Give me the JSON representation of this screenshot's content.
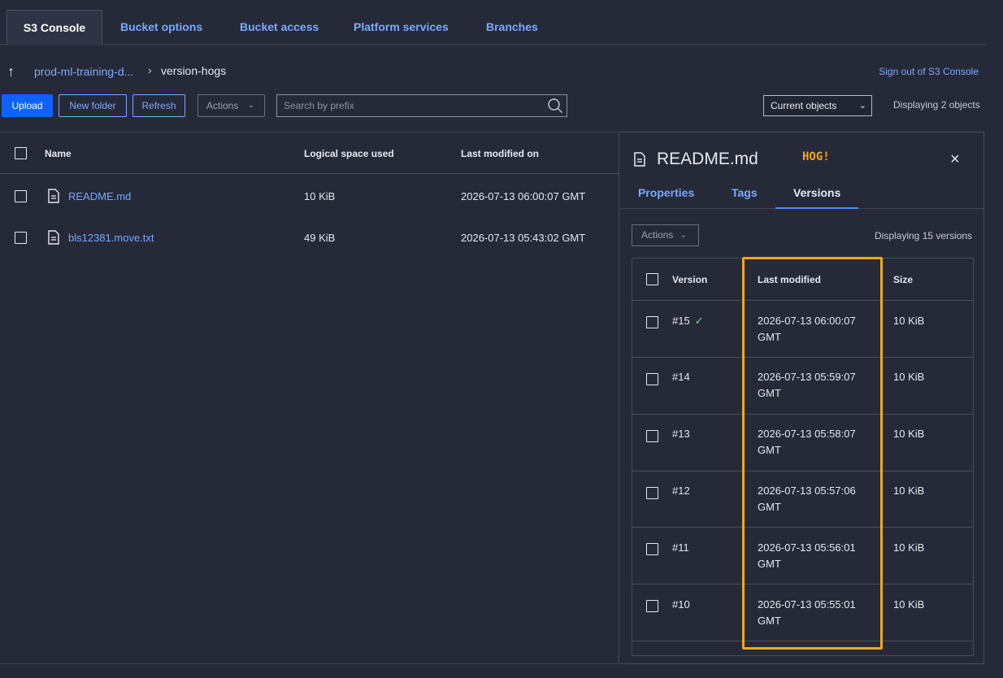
{
  "tabs": [
    {
      "label": "S3 Console"
    },
    {
      "label": "Bucket options"
    },
    {
      "label": "Bucket access"
    },
    {
      "label": "Platform services"
    },
    {
      "label": "Branches"
    }
  ],
  "breadcrumb": {
    "parent": "prod-ml-training-d...",
    "current": "version-hogs"
  },
  "signout_label": "Sign out of S3 Console",
  "toolbar": {
    "upload": "Upload",
    "new_folder": "New folder",
    "refresh": "Refresh",
    "actions": "Actions",
    "search_placeholder": "Search by prefix",
    "view_select": "Current objects",
    "display_count": "Displaying 2 objects"
  },
  "objects_table": {
    "headers": {
      "name": "Name",
      "size": "Logical space used",
      "modified": "Last modified on"
    },
    "rows": [
      {
        "name": "README.md",
        "size": "10 KiB",
        "modified": "2026-07-13 06:00:07 GMT"
      },
      {
        "name": "bls12381.move.txt",
        "size": "49 KiB",
        "modified": "2026-07-13 05:43:02 GMT"
      }
    ]
  },
  "detail_panel": {
    "title": "README.md",
    "badge": "HOG!",
    "close": "×",
    "tabs": {
      "properties": "Properties",
      "tags": "Tags",
      "versions": "Versions"
    },
    "actions": "Actions",
    "versions_count": "Displaying 15 versions",
    "versions_table": {
      "headers": {
        "version": "Version",
        "modified": "Last modified",
        "size": "Size"
      },
      "rows": [
        {
          "version": "#15",
          "date": "2026-07-13 06:00:07",
          "tz": "GMT",
          "size": "10 KiB",
          "current": true
        },
        {
          "version": "#14",
          "date": "2026-07-13 05:59:07",
          "tz": "GMT",
          "size": "10 KiB",
          "current": false
        },
        {
          "version": "#13",
          "date": "2026-07-13 05:58:07",
          "tz": "GMT",
          "size": "10 KiB",
          "current": false
        },
        {
          "version": "#12",
          "date": "2026-07-13 05:57:06",
          "tz": "GMT",
          "size": "10 KiB",
          "current": false
        },
        {
          "version": "#11",
          "date": "2026-07-13 05:56:01",
          "tz": "GMT",
          "size": "10 KiB",
          "current": false
        },
        {
          "version": "#10",
          "date": "2026-07-13 05:55:01",
          "tz": "GMT",
          "size": "10 KiB",
          "current": false
        }
      ]
    }
  },
  "colors": {
    "background": "#262a38",
    "link": "#78a9ff",
    "primary": "#0f62fe",
    "highlight": "#f1a817",
    "check": "#6fdc8c"
  }
}
